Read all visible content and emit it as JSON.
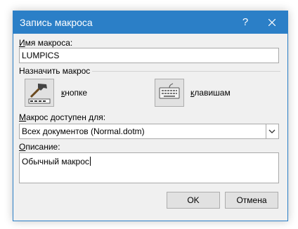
{
  "window": {
    "title": "Запись макроса",
    "help_label": "?",
    "close_icon": "close-icon"
  },
  "macro_name": {
    "label": "Имя макроса:",
    "value": "LUMPICS"
  },
  "assign": {
    "group_label": "Назначить макрос",
    "button_label": "кнопке",
    "button_icon": "hammer-icon",
    "keyboard_label": "клавишам",
    "keyboard_icon": "keyboard-icon"
  },
  "store": {
    "label": "Макрос доступен для:",
    "selected": "Всех документов (Normal.dotm)"
  },
  "description": {
    "label": "Описание:",
    "value": "Обычный макрос"
  },
  "buttons": {
    "ok": "OK",
    "cancel": "Отмена"
  },
  "colors": {
    "titlebar": "#2b7fc7",
    "dialog_bg": "#f0f0f0",
    "button_bg": "#e1e1e1"
  }
}
